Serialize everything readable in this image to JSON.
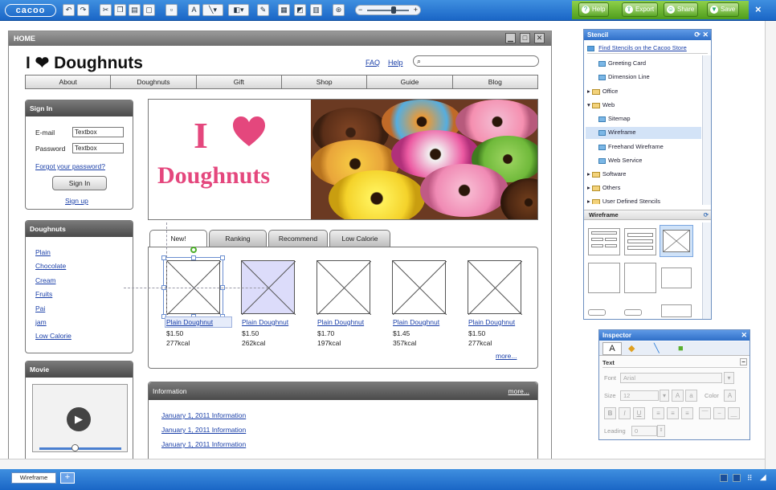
{
  "toolbar": {
    "logo": "cacoo",
    "help": "Help",
    "export": "Export",
    "share": "Share",
    "save": "Save",
    "close": "×"
  },
  "window": {
    "title": "HOME"
  },
  "site": {
    "title": "I ❤ Doughnuts",
    "faq": "FAQ",
    "help": "Help",
    "nav": [
      "About",
      "Doughnuts",
      "Gift",
      "Shop",
      "Guide",
      "Blog"
    ]
  },
  "signin": {
    "title": "Sign In",
    "email_label": "E-mail",
    "email_value": "Textbox",
    "password_label": "Password",
    "password_value": "Textbox",
    "forgot": "Forgot your password?",
    "button": "Sign In",
    "signup": "Sign up"
  },
  "doughnuts": {
    "title": "Doughnuts",
    "items": [
      "Plain",
      "Chocolate",
      "Cream",
      "Fruits",
      "Pai",
      "jam",
      "Low Calorie"
    ]
  },
  "movie": {
    "title": "Movie"
  },
  "hero": {
    "i": "I",
    "word": "Doughnuts"
  },
  "tabs": [
    "New!",
    "Ranking",
    "Recommend",
    "Low Calorie"
  ],
  "products": [
    {
      "name": "Plain Doughnut",
      "price": "$1.50",
      "kcal": "277kcal"
    },
    {
      "name": "Plain Doughnut",
      "price": "$1.50",
      "kcal": "262kcal"
    },
    {
      "name": "Plain Doughnut",
      "price": "$1.70",
      "kcal": "197kcal"
    },
    {
      "name": "Plain Doughnut",
      "price": "$1.45",
      "kcal": "357kcal"
    },
    {
      "name": "Plain Doughnut",
      "price": "$1.50",
      "kcal": "277kcal"
    }
  ],
  "more": "more...",
  "information": {
    "title": "Information",
    "more": "more...",
    "items": [
      "January 1, 2011 Information",
      "January 1, 2011 Information",
      "January 1, 2011 Information"
    ]
  },
  "stencil": {
    "title": "Stencil",
    "store_link": "Find Stencils on the Cacoo Store",
    "tree": [
      {
        "label": "Greeting Card",
        "kind": "item"
      },
      {
        "label": "Dimension Line",
        "kind": "item"
      },
      {
        "label": "Office",
        "kind": "folder"
      },
      {
        "label": "Web",
        "kind": "folder"
      },
      {
        "label": "Sitemap",
        "kind": "item"
      },
      {
        "label": "Wireframe",
        "kind": "item"
      },
      {
        "label": "Freehand Wireframe",
        "kind": "item"
      },
      {
        "label": "Web Service",
        "kind": "item"
      },
      {
        "label": "Software",
        "kind": "folder"
      },
      {
        "label": "Others",
        "kind": "folder"
      },
      {
        "label": "User Defined Stencils",
        "kind": "folder"
      }
    ],
    "sub_title": "Wireframe"
  },
  "inspector": {
    "title": "Inspector",
    "section": "Text",
    "font_label": "Font",
    "font_value": "Arial",
    "size_label": "Size",
    "size_value": "12",
    "color_label": "Color",
    "leading_label": "Leading",
    "leading_value": "0"
  },
  "bottom": {
    "tab": "Wireframe",
    "add": "+"
  }
}
